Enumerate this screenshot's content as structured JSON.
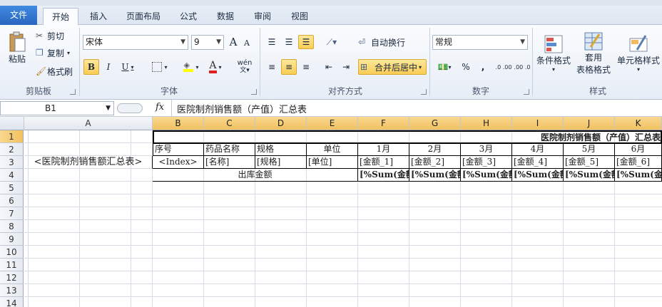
{
  "ribbon_tabs": [
    "文件",
    "开始",
    "插入",
    "页面布局",
    "公式",
    "数据",
    "审阅",
    "视图"
  ],
  "clipboard": {
    "paste": "粘贴",
    "cut": "剪切",
    "copy": "复制",
    "format_painter": "格式刷",
    "group": "剪贴板"
  },
  "font": {
    "name": "宋体",
    "size": "9",
    "group": "字体",
    "bold": "B",
    "italic": "I",
    "underline": "U",
    "phonetic": "wén",
    "grow": "A",
    "shrink": "A"
  },
  "alignment": {
    "wrap": "自动换行",
    "merge": "合并后居中",
    "group": "对齐方式"
  },
  "number": {
    "format": "常规",
    "percent": "%",
    "comma": ",",
    "inc": ".0 .00",
    "dec": ".00 .0",
    "group": "数字"
  },
  "styles": {
    "conditional": "条件格式",
    "table_line1": "套用",
    "table_line2": "表格格式",
    "cell_styles": "单元格样式",
    "group": "样式"
  },
  "formula_bar": {
    "name_box": "B1",
    "fx": "fx",
    "value": "医院制剂销售额（产值）汇总表"
  },
  "columns": [
    "A",
    "B",
    "C",
    "D",
    "E",
    "F",
    "G",
    "H",
    "I",
    "J",
    "K"
  ],
  "rows": [
    "1",
    "2",
    "3",
    "4",
    "5",
    "6",
    "7",
    "8",
    "9",
    "10",
    "11",
    "12",
    "13",
    "14"
  ],
  "cells": {
    "A3": "<医院制剂销售额汇总表>",
    "B1": "医院制剂销售额（产值）汇总表",
    "row2": [
      "序号",
      "药品名称",
      "规格",
      "单位",
      "1月",
      "2月",
      "3月",
      "4月",
      "5月",
      "6月"
    ],
    "row3": [
      "<Index>",
      "[名称]",
      "[规格]",
      "[单位]",
      "[金额_1]",
      "[金额_2]",
      "[金额_3]",
      "[金额_4]",
      "[金额_5]",
      "[金额_6]"
    ],
    "B4": "出库金额",
    "row4": [
      "[%Sum(金额",
      "[%Sum(金额",
      "[%Sum(金额",
      "[%Sum(金额",
      "[%Sum(金额",
      "[%Sum(金额"
    ]
  }
}
